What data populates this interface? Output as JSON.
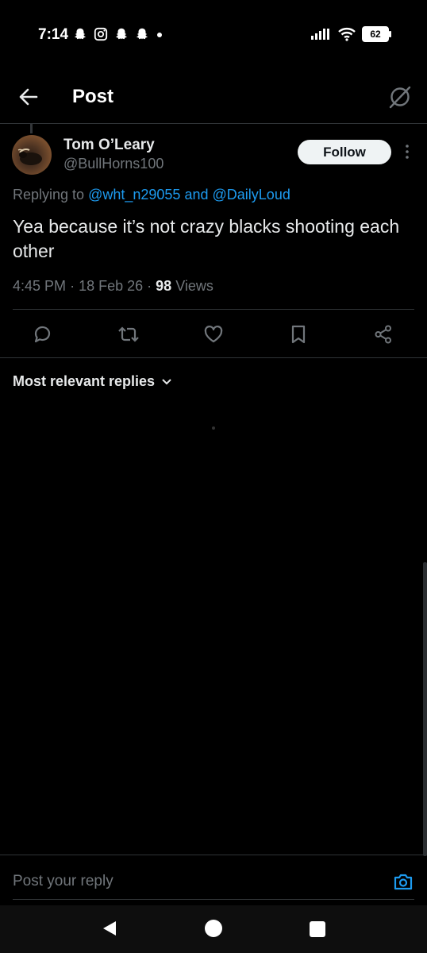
{
  "status_bar": {
    "time": "7:14",
    "battery": "62"
  },
  "header": {
    "title": "Post"
  },
  "post": {
    "name": "Tom O’Leary",
    "handle": "@BullHorns100",
    "follow_label": "Follow",
    "replying_prefix": "Replying to",
    "mention1": "@wht_n29055",
    "and": "and",
    "mention2": "@DailyLoud",
    "text": "Yea because it’s not crazy blacks shooting each other",
    "time": "4:45 PM",
    "date": "18 Feb 26",
    "views_count": "98",
    "views_label": "Views"
  },
  "replies": {
    "sort_label": "Most relevant replies"
  },
  "composer": {
    "placeholder": "Post your reply"
  },
  "icons": {
    "back": "arrow-left-icon",
    "grok": "grok-icon",
    "more": "more-vertical-icon",
    "reply": "reply-icon",
    "repost": "repost-icon",
    "like": "heart-icon",
    "bookmark": "bookmark-icon",
    "share": "share-icon",
    "camera": "camera-icon"
  },
  "colors": {
    "accent": "#1d9bf0",
    "muted": "#71767b",
    "text": "#e7e9ea",
    "background": "#000000"
  }
}
